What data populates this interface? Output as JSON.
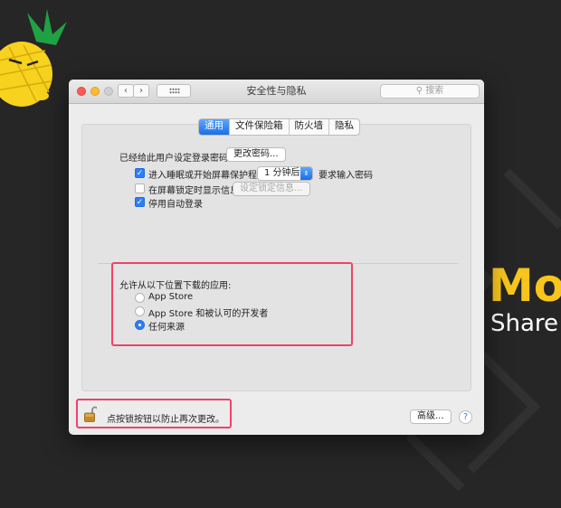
{
  "brand": {
    "text": "Mo",
    "subtext": "Share"
  },
  "window": {
    "title": "安全性与隐私",
    "search_placeholder": "搜索",
    "nav_back": "‹",
    "nav_forward": "›"
  },
  "tabs": [
    {
      "label": "通用",
      "active": true
    },
    {
      "label": "文件保险箱",
      "active": false
    },
    {
      "label": "防火墙",
      "active": false
    },
    {
      "label": "隐私",
      "active": false
    }
  ],
  "general": {
    "login_password_label": "已经给此用户设定登录密码",
    "change_password_button": "更改密码...",
    "require_password": {
      "label": "进入睡眠或开始屏幕保护程序",
      "checked": true
    },
    "require_delay_value": "1 分钟后",
    "require_password_suffix": "要求输入密码",
    "show_message": {
      "label": "在屏幕锁定时显示信息",
      "checked": false
    },
    "set_lock_message_button": "设定锁定信息...",
    "disable_auto_login": {
      "label": "停用自动登录",
      "checked": true
    }
  },
  "downloads": {
    "title": "允许从以下位置下载的应用:",
    "options": [
      {
        "label": "App Store",
        "selected": false
      },
      {
        "label": "App Store 和被认可的开发者",
        "selected": false
      },
      {
        "label": "任何来源",
        "selected": true
      }
    ]
  },
  "footer": {
    "lock_text": "点按锁按钮以防止再次更改。",
    "advanced_button": "高级...",
    "help_label": "?"
  },
  "colors": {
    "accent": "#2d7ef7",
    "highlight": "#f0426a",
    "brand": "#f7c51c",
    "background": "#262626"
  }
}
